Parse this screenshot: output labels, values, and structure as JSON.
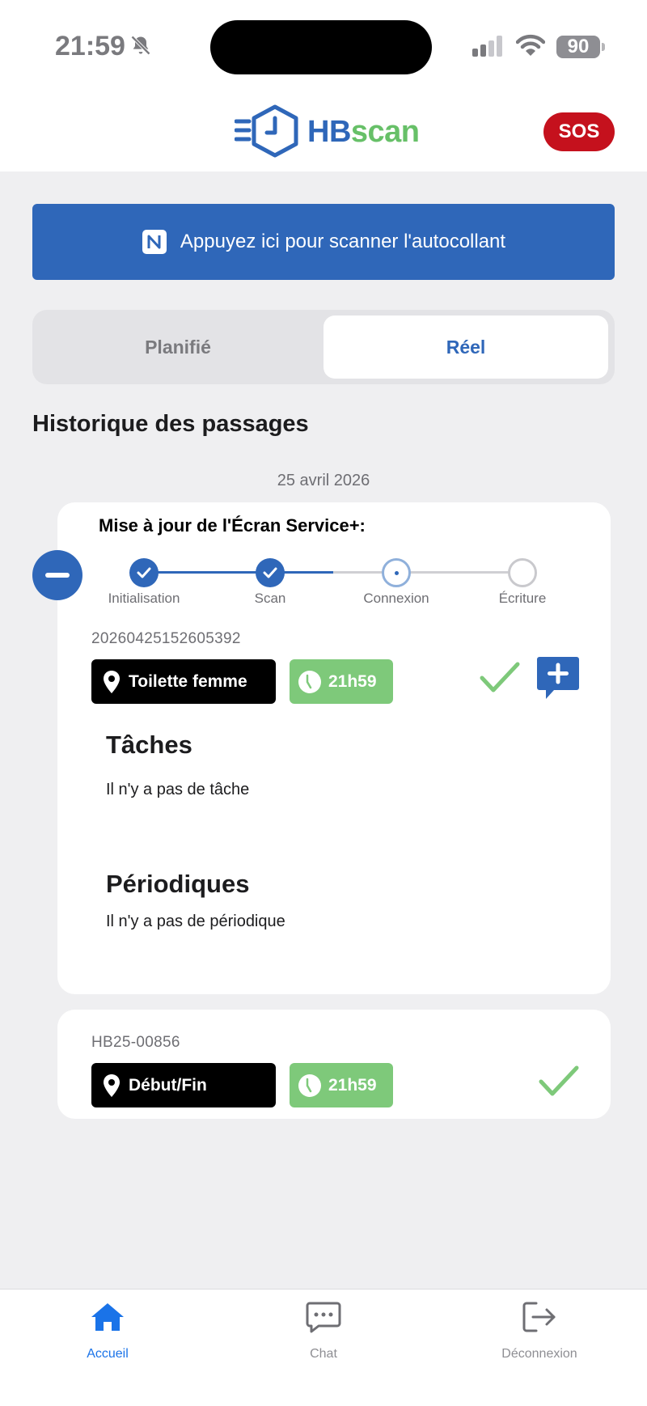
{
  "status_bar": {
    "time": "21:59",
    "battery": "90",
    "icons": [
      "bell-slash-icon",
      "signal-icon",
      "wifi-icon",
      "battery-icon"
    ]
  },
  "header": {
    "logo_hb": "HB",
    "logo_scan": "scan",
    "sos_label": "SOS",
    "brand_colors": {
      "blue": "#2f67b9",
      "green": "#67c068",
      "sos": "#c5111d"
    }
  },
  "scan_banner": {
    "label": "Appuyez ici pour scanner l'autocollant",
    "icon": "nfc-icon"
  },
  "segment": {
    "left_label": "Planifié",
    "right_label": "Réel",
    "selected": "Réel"
  },
  "history": {
    "title": "Historique des passages",
    "date": "25 avril 2026"
  },
  "update_card": {
    "heading": "Mise à jour de l'Écran Service+:",
    "steps": [
      {
        "label": "Initialisation",
        "state": "done"
      },
      {
        "label": "Scan",
        "state": "done"
      },
      {
        "label": "Connexion",
        "state": "active"
      },
      {
        "label": "Écriture",
        "state": "todo"
      }
    ],
    "passage": {
      "reference": "20260425152605392",
      "location": "Toilette femme",
      "time": "21h59",
      "status": "validated"
    },
    "tasks_title": "Tâches",
    "tasks_empty": "Il n'y a pas de tâche",
    "periodic_title": "Périodiques",
    "periodic_empty": "Il n'y a pas de périodique"
  },
  "second_card": {
    "reference": "HB25-00856",
    "location": "Début/Fin",
    "time": "21h59",
    "status": "validated"
  },
  "tabbar": {
    "items": [
      {
        "label": "Accueil",
        "icon": "home-icon",
        "active": true
      },
      {
        "label": "Chat",
        "icon": "chat-icon",
        "active": false
      },
      {
        "label": "Déconnexion",
        "icon": "logout-icon",
        "active": false
      }
    ]
  }
}
